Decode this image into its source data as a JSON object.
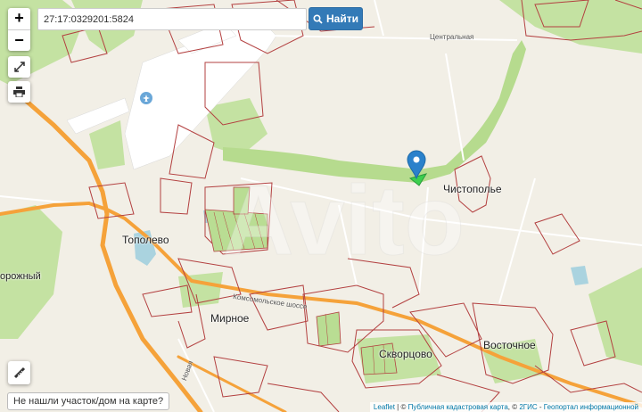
{
  "search": {
    "value": "27:17:0329201:5824",
    "button_label": "Найти"
  },
  "zoom": {
    "in_label": "+",
    "out_label": "−"
  },
  "places": {
    "chistopolye": "Чистополье",
    "topolevo": "Тополево",
    "mirnoe": "Мирное",
    "skvortsovo": "Скворцово",
    "vostochnoe": "Восточное",
    "dorozhny": "орожный"
  },
  "streets": {
    "tsentralnaya": "Центральная",
    "komsomolskoe": "Комсомольское шоссе",
    "novaya": "Новая"
  },
  "watermark": "Avito",
  "not_found_label": "Не нашли участок/дом на карте?",
  "attribution": {
    "leaflet": "Leaflet",
    "sep1": " | © ",
    "pkk": "Публичная кадастровая карта",
    "sep2": ", © ",
    "dgis": "2ГИС",
    "sep3": " - ",
    "geo": "Геопортал информационной"
  },
  "colors": {
    "background": "#f2efe6",
    "green": "#b9dd93",
    "road_major": "#f5a23a",
    "cadastral": "#b34040",
    "marker": "#2a81cb",
    "button": "#337ab7"
  },
  "icons": [
    "airport-icon",
    "fullscreen-icon",
    "print-icon",
    "ruler-icon",
    "search-icon",
    "location-marker-icon"
  ]
}
